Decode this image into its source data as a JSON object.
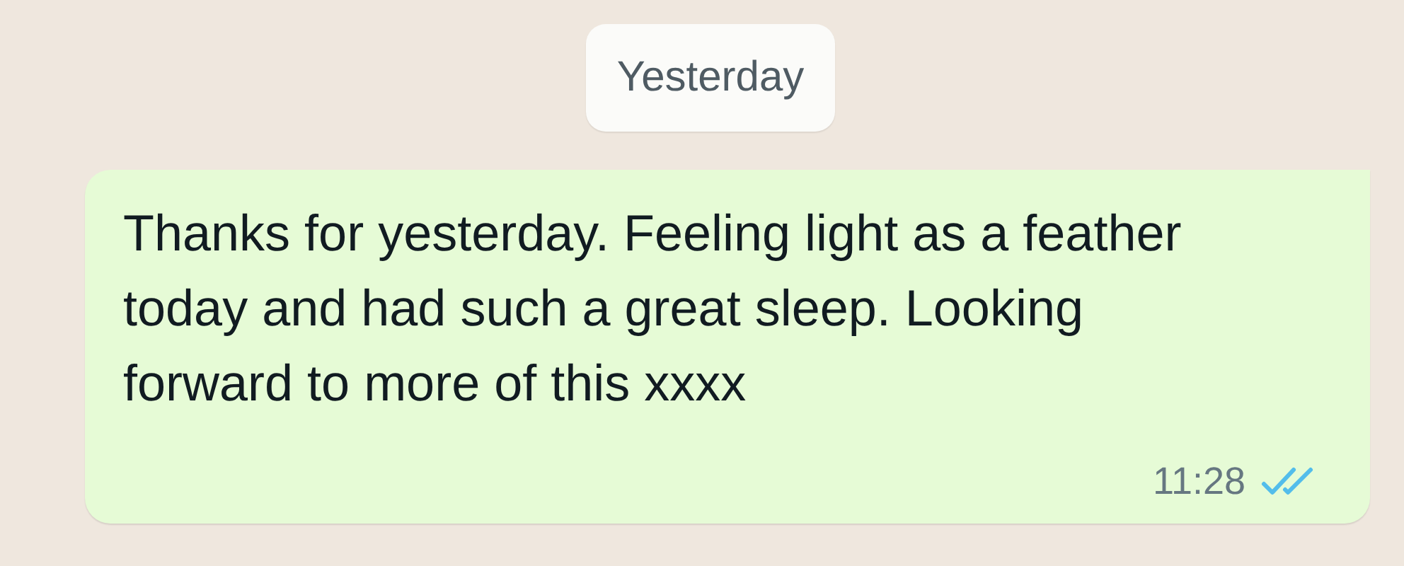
{
  "date_chip": "Yesterday",
  "message": {
    "text": "Thanks for yesterday. Feeling light as a feather today and had such a great sleep. Looking forward to more of this xxxx",
    "time": "11:28",
    "read": true
  }
}
